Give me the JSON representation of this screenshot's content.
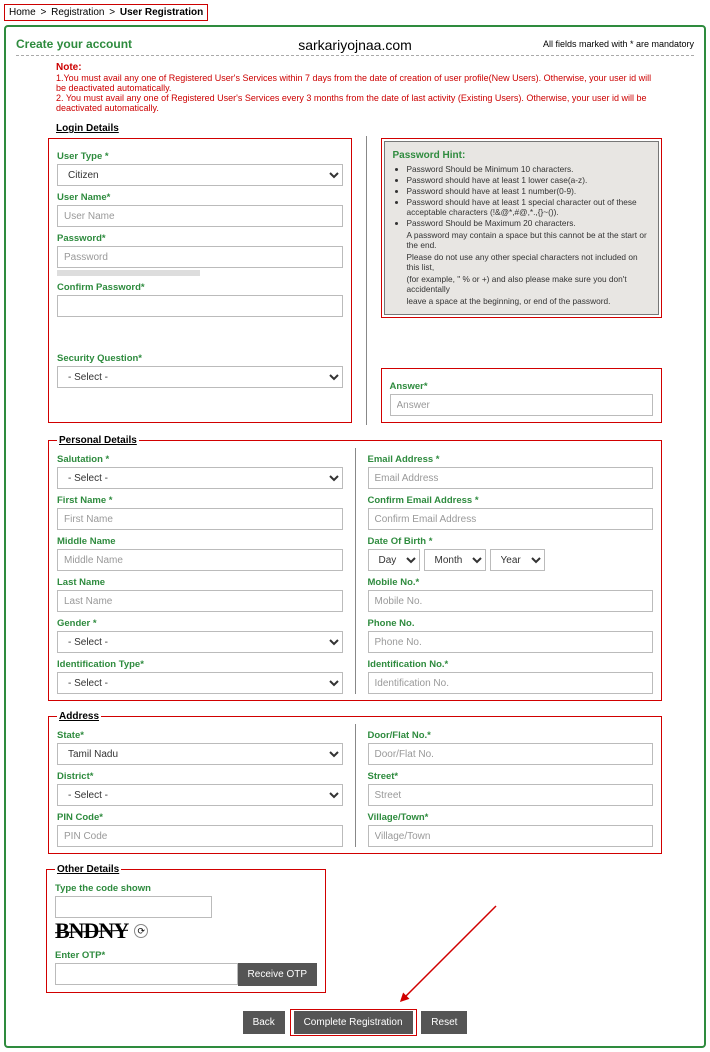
{
  "breadcrumb": {
    "home": "Home",
    "reg": "Registration",
    "user": "User Registration"
  },
  "header": {
    "create": "Create your account",
    "watermark": "sarkariyojnaa.com",
    "mandatory": "All fields marked with * are mandatory"
  },
  "note": {
    "title": "Note:",
    "line1": "1.You must avail any one of Registered User's Services within 7 days from the date of creation of user profile(New Users). Otherwise, your user id will be deactivated automatically.",
    "line2": "2. You must avail any one of Registered User's Services every 3 months from the date of last activity (Existing Users). Otherwise, your user id will be deactivated automatically."
  },
  "login": {
    "section": "Login Details",
    "usertype_l": "User Type *",
    "usertype_v": "Citizen",
    "username_l": "User Name*",
    "username_ph": "User Name",
    "password_l": "Password*",
    "password_ph": "Password",
    "confirm_l": "Confirm Password*",
    "secq_l": "Security Question*",
    "secq_v": "- Select -",
    "answer_l": "Answer*",
    "answer_ph": "Answer"
  },
  "hint": {
    "title": "Password Hint:",
    "b1": "Password Should be Minimum 10 characters.",
    "b2": "Password should have at least 1 lower case(a-z).",
    "b3": "Password should have at least 1 number(0-9).",
    "b4": "Password should have at least 1 special character out of these acceptable characters (!&@*,#@,*.,{}~()).",
    "b5": "Password Should be Maximum 20 characters.",
    "n1": "A password may contain a space but this cannot be at the start or the end.",
    "n2": "Please do not use any other special characters not included on this list,",
    "n3": "(for example, \" % or +) and also please make sure you don't accidentally",
    "n4": "leave a space at the beginning, or end of the password."
  },
  "personal": {
    "legend": "Personal Details",
    "sal_l": "Salutation *",
    "sal_v": "- Select -",
    "fn_l": "First Name *",
    "fn_ph": "First Name",
    "mn_l": "Middle Name",
    "mn_ph": "Middle Name",
    "ln_l": "Last Name",
    "ln_ph": "Last Name",
    "gender_l": "Gender *",
    "gender_v": "- Select -",
    "idtype_l": "Identification Type*",
    "idtype_v": "- Select -",
    "email_l": "Email Address *",
    "email_ph": "Email Address",
    "cemail_l": "Confirm Email Address *",
    "cemail_ph": "Confirm Email Address",
    "dob_l": "Date Of Birth *",
    "dob_d": "Day",
    "dob_m": "Month",
    "dob_y": "Year",
    "mobile_l": "Mobile No.*",
    "mobile_ph": "Mobile No.",
    "phone_l": "Phone No.",
    "phone_ph": "Phone No.",
    "idno_l": "Identification No.*",
    "idno_ph": "Identification No."
  },
  "address": {
    "legend": "Address",
    "state_l": "State*",
    "state_v": "Tamil Nadu",
    "district_l": "District*",
    "district_v": "- Select -",
    "pin_l": "PIN Code*",
    "pin_ph": "PIN Code",
    "door_l": "Door/Flat No.*",
    "door_ph": "Door/Flat No.",
    "street_l": "Street*",
    "street_ph": "Street",
    "village_l": "Village/Town*",
    "village_ph": "Village/Town"
  },
  "other": {
    "legend": "Other Details",
    "code_l": "Type the code shown",
    "captcha": "BNDNY",
    "otp_l": "Enter OTP*",
    "receive": "Receive OTP"
  },
  "buttons": {
    "back": "Back",
    "complete": "Complete Registration",
    "reset": "Reset"
  }
}
